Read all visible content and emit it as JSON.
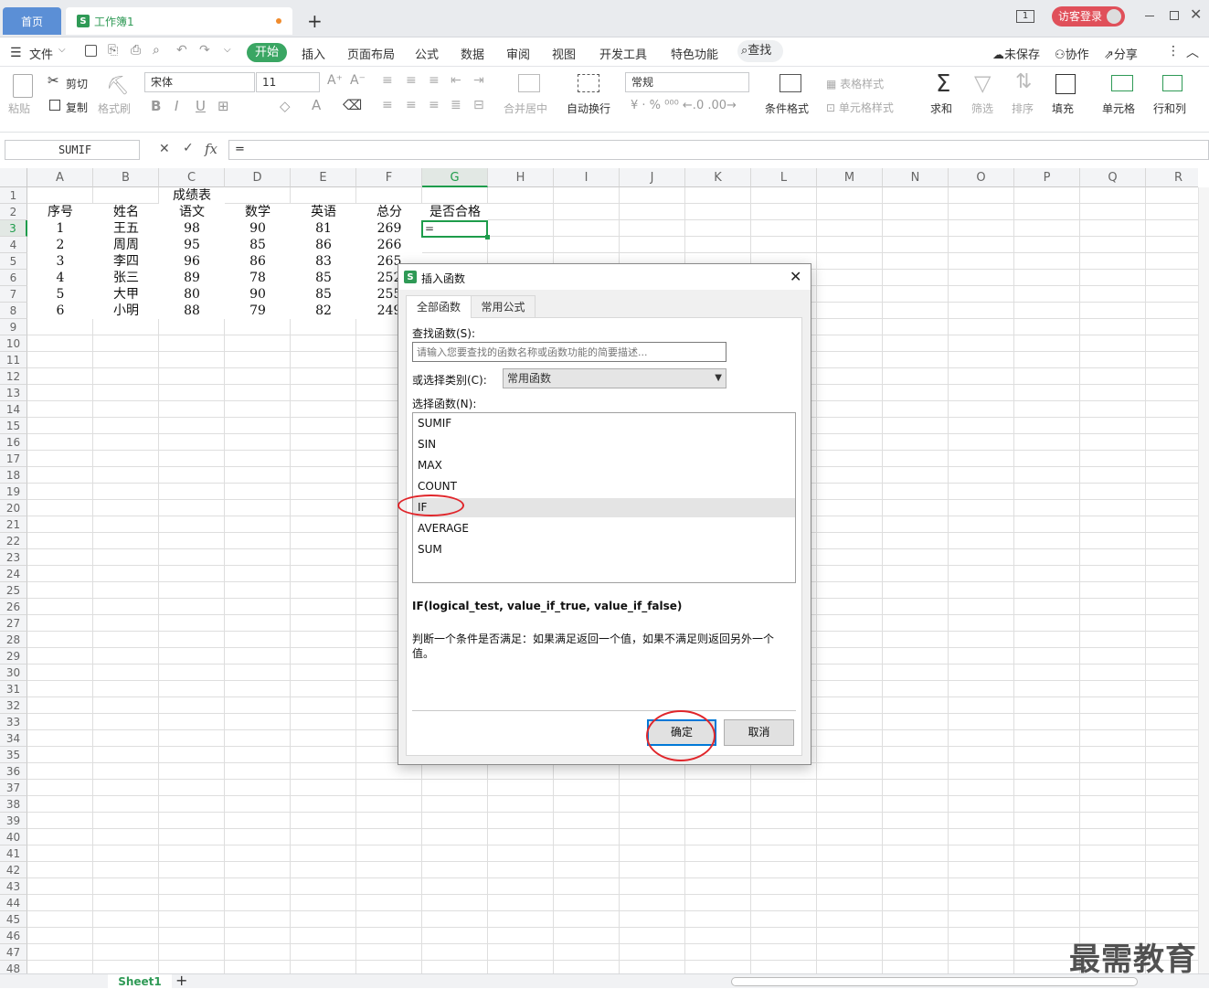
{
  "titlebar": {
    "home_tab": "首页",
    "book_tab": "工作簿1",
    "add_tab": "+",
    "visitor_login": "访客登录",
    "page_indicator": "1"
  },
  "menubar": {
    "file": "文件",
    "items": [
      "开始",
      "插入",
      "页面布局",
      "公式",
      "数据",
      "审阅",
      "视图",
      "开发工具",
      "特色功能"
    ],
    "search": "查找",
    "unsaved": "未保存",
    "collab": "协作",
    "share": "分享"
  },
  "ribbon": {
    "paste": "粘贴",
    "cut": "剪切",
    "copy": "复制",
    "format_painter": "格式刷",
    "font_name": "宋体",
    "font_size": "11",
    "merge_center": "合并居中",
    "wrap_text": "自动换行",
    "number_format": "常规",
    "cond_format": "条件格式",
    "table_style": "表格样式",
    "cell_style": "单元格样式",
    "sum": "求和",
    "filter": "筛选",
    "sort": "排序",
    "fill": "填充",
    "cell": "单元格",
    "row_col": "行和列"
  },
  "formula": {
    "name_box": "SUMIF",
    "fx": "fx",
    "content": "="
  },
  "grid": {
    "columns": [
      "A",
      "B",
      "C",
      "D",
      "E",
      "F",
      "G",
      "H",
      "I",
      "J",
      "K",
      "L",
      "M",
      "N",
      "O",
      "P",
      "Q",
      "R"
    ],
    "title": "成绩表",
    "headers": [
      "序号",
      "姓名",
      "语文",
      "数学",
      "英语",
      "总分",
      "是否合格"
    ],
    "rows": [
      [
        "1",
        "王五",
        "98",
        "90",
        "81",
        "269"
      ],
      [
        "2",
        "周周",
        "95",
        "85",
        "86",
        "266"
      ],
      [
        "3",
        "李四",
        "96",
        "86",
        "83",
        "265"
      ],
      [
        "4",
        "张三",
        "89",
        "78",
        "85",
        "252"
      ],
      [
        "5",
        "大甲",
        "80",
        "90",
        "85",
        "255"
      ],
      [
        "6",
        "小明",
        "88",
        "79",
        "82",
        "249"
      ]
    ],
    "active_cell_value": "="
  },
  "dialog": {
    "title": "插入函数",
    "tab_all": "全部函数",
    "tab_common": "常用公式",
    "search_label": "查找函数(S):",
    "search_placeholder": "请输入您要查找的函数名称或函数功能的简要描述...",
    "category_label": "或选择类别(C):",
    "category_value": "常用函数",
    "select_label": "选择函数(N):",
    "functions": [
      "SUMIF",
      "SIN",
      "MAX",
      "COUNT",
      "IF",
      "AVERAGE",
      "SUM"
    ],
    "selected_function": "IF",
    "signature": "IF(logical_test, value_if_true, value_if_false)",
    "description": "判断一个条件是否满足：如果满足返回一个值，如果不满足则返回另外一个值。",
    "ok": "确定",
    "cancel": "取消"
  },
  "sheet": {
    "tab": "Sheet1",
    "add": "+"
  },
  "watermark": "最需教育",
  "colors": {
    "accent": "#3aa663",
    "selection": "#1e9c4b",
    "annotation": "#e0262b",
    "home_tab": "#5b8fd6"
  }
}
